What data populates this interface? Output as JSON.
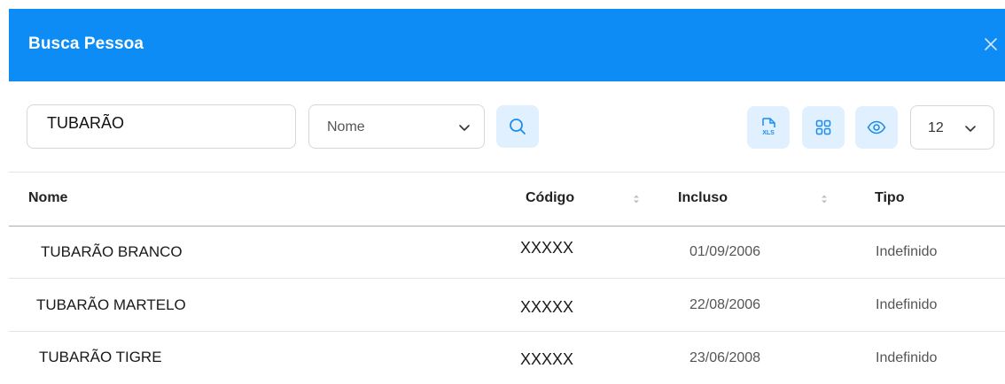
{
  "header": {
    "title": "Busca Pessoa",
    "close_icon": "close-icon"
  },
  "toolbar": {
    "search_value": "TUBARÃO",
    "field_select": {
      "selected": "Nome"
    },
    "search_button_icon": "search-icon",
    "export_xls_icon": "xls-file-icon",
    "grid_view_icon": "grid-icon",
    "visibility_icon": "eye-icon",
    "page_size": {
      "selected": "12"
    }
  },
  "table": {
    "columns": [
      "Nome",
      "Código",
      "Incluso",
      "Tipo"
    ],
    "rows": [
      {
        "nome": "TUBARÃO BRANCO",
        "codigo": "XXXXX",
        "incluso": "01/09/2006",
        "tipo": "Indefinido"
      },
      {
        "nome": "TUBARÃO MARTELO",
        "codigo": "XXXXX",
        "incluso": "22/08/2006",
        "tipo": "Indefinido"
      },
      {
        "nome": "TUBARÃO TIGRE",
        "codigo": "XXXXX",
        "incluso": "23/06/2008",
        "tipo": "Indefinido"
      }
    ]
  },
  "colors": {
    "header_bg": "#0d8cf5",
    "accent": "#1a8cf0",
    "icon_button_bg": "#e1f0fe"
  }
}
